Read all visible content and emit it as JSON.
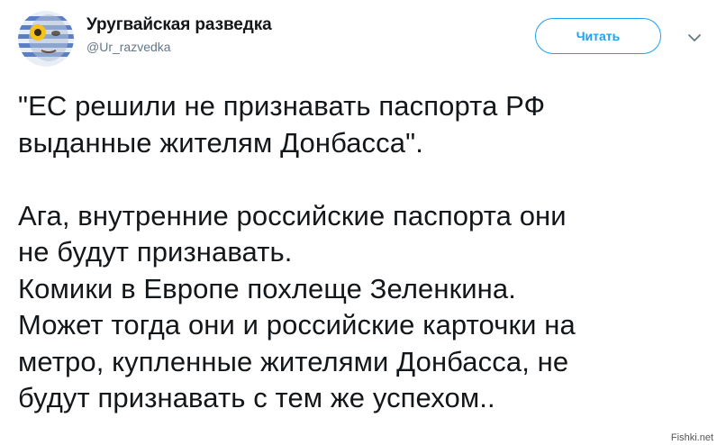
{
  "tweet": {
    "author": {
      "display_name": "Уругвайская разведка",
      "handle": "@Ur_razvedka"
    },
    "follow_label": "Читать",
    "caret_icon": "chevron-down-icon",
    "text_paragraphs": [
      "\"ЕС решили не признавать паспорта РФ\nвыданные жителям Донбасса\".",
      "",
      "Ага, внутренние российские паспорта они\nне будут признавать.\nКомики в Европе похлеще Зеленкина.\nМожет тогда они и российские карточки на\nметро, купленные жителями Донбасса, не\nбудут признавать с тем же успехом.."
    ]
  },
  "watermark": "Fishki.net",
  "colors": {
    "accent": "#1da1f2",
    "text": "#14171a",
    "secondary": "#657786"
  }
}
